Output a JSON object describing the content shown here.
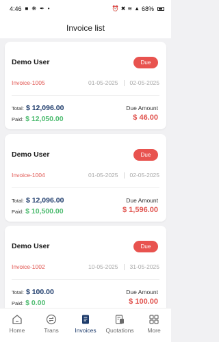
{
  "status_bar": {
    "time": "4:46",
    "battery": "68%"
  },
  "header": {
    "title": "Invoice list"
  },
  "invoices": [
    {
      "name": "Demo User",
      "badge": "Due",
      "invoice_no": "Invoice-1005",
      "date_from": "01-05-2025",
      "date_to": "02-05-2025",
      "total_label": "Total:",
      "total": "$ 12,096.00",
      "paid_label": "Paid:",
      "paid": "$ 12,050.00",
      "due_label": "Due Amount",
      "due": "$ 46.00"
    },
    {
      "name": "Demo User",
      "badge": "Due",
      "invoice_no": "Invoice-1004",
      "date_from": "01-05-2025",
      "date_to": "02-05-2025",
      "total_label": "Total:",
      "total": "$ 12,096.00",
      "paid_label": "Paid:",
      "paid": "$ 10,500.00",
      "due_label": "Due Amount",
      "due": "$ 1,596.00"
    },
    {
      "name": "Demo User",
      "badge": "Due",
      "invoice_no": "Invoice-1002",
      "date_from": "10-05-2025",
      "date_to": "31-05-2025",
      "total_label": "Total:",
      "total": "$ 100.00",
      "paid_label": "Paid:",
      "paid": "$ 0.00",
      "due_label": "Due Amount",
      "due": "$ 100.00"
    }
  ],
  "bottom_nav": [
    {
      "label": "Home",
      "icon": "home-icon"
    },
    {
      "label": "Trans",
      "icon": "transfer-icon"
    },
    {
      "label": "Invoices",
      "icon": "invoice-icon",
      "active": true
    },
    {
      "label": "Quotations",
      "icon": "quotation-icon"
    },
    {
      "label": "More",
      "icon": "grid-icon"
    }
  ],
  "colors": {
    "accent": "#1d3b6b",
    "due_red": "#e0524d",
    "paid_green": "#4cbb6f",
    "badge_red": "#e8534f"
  }
}
